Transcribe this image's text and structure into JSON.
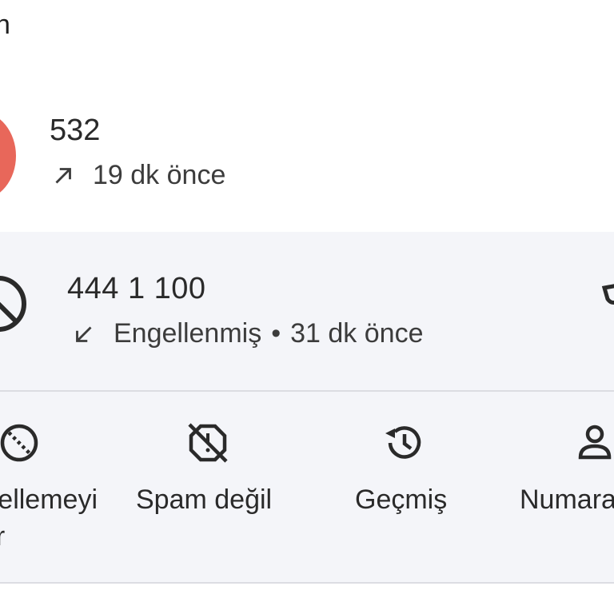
{
  "header": {
    "title_fragment": "n"
  },
  "calls": [
    {
      "number": "532",
      "direction": "outgoing",
      "direction_icon": "arrow-up-right-icon",
      "meta": "19 dk önce",
      "avatar_color": "#e8675a"
    },
    {
      "number": "444 1 100",
      "direction": "incoming",
      "direction_icon": "arrow-down-left-icon",
      "status": "Engellenmiş",
      "separator": "•",
      "time": "31 dk önce",
      "avatar_icon": "blocked-icon"
    }
  ],
  "actions": [
    {
      "icon": "unblock-icon",
      "label_line1": "ellemeyi",
      "label_line2": "aldır"
    },
    {
      "icon": "not-spam-icon",
      "label": "Spam değil"
    },
    {
      "icon": "history-icon",
      "label": "Geçmiş"
    },
    {
      "icon": "add-contact-icon",
      "label": "Numara"
    }
  ],
  "colors": {
    "expanded_background": "#f4f5f9",
    "divider": "#dcdde2",
    "text": "#1f1f1f"
  }
}
